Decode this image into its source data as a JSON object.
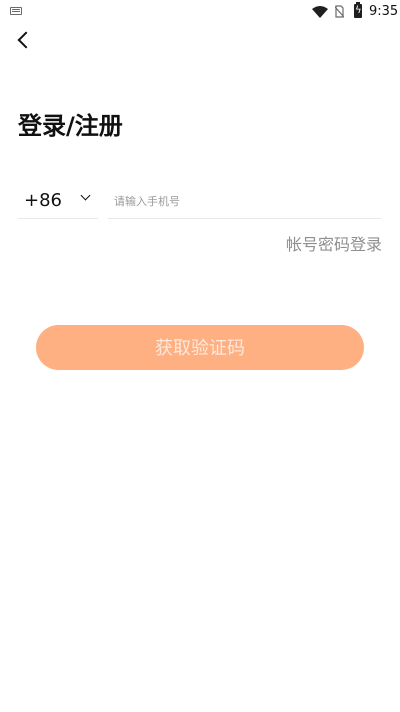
{
  "status_bar": {
    "time": "9:35",
    "icons": [
      "keyboard-icon",
      "wifi-icon",
      "no-sim-icon",
      "battery-charging-icon"
    ]
  },
  "header": {
    "back_icon": "chevron-left-icon",
    "title": "登录/注册"
  },
  "form": {
    "country_code": "+86",
    "phone_placeholder": "请输入手机号",
    "phone_value": "",
    "password_login_link": "帐号密码登录",
    "get_code_button": "获取验证码"
  },
  "colors": {
    "button_bg": "#ffb082",
    "button_text": "#ffe8db",
    "link_text": "#8f8f8f",
    "placeholder_text": "#9a9a9a"
  }
}
